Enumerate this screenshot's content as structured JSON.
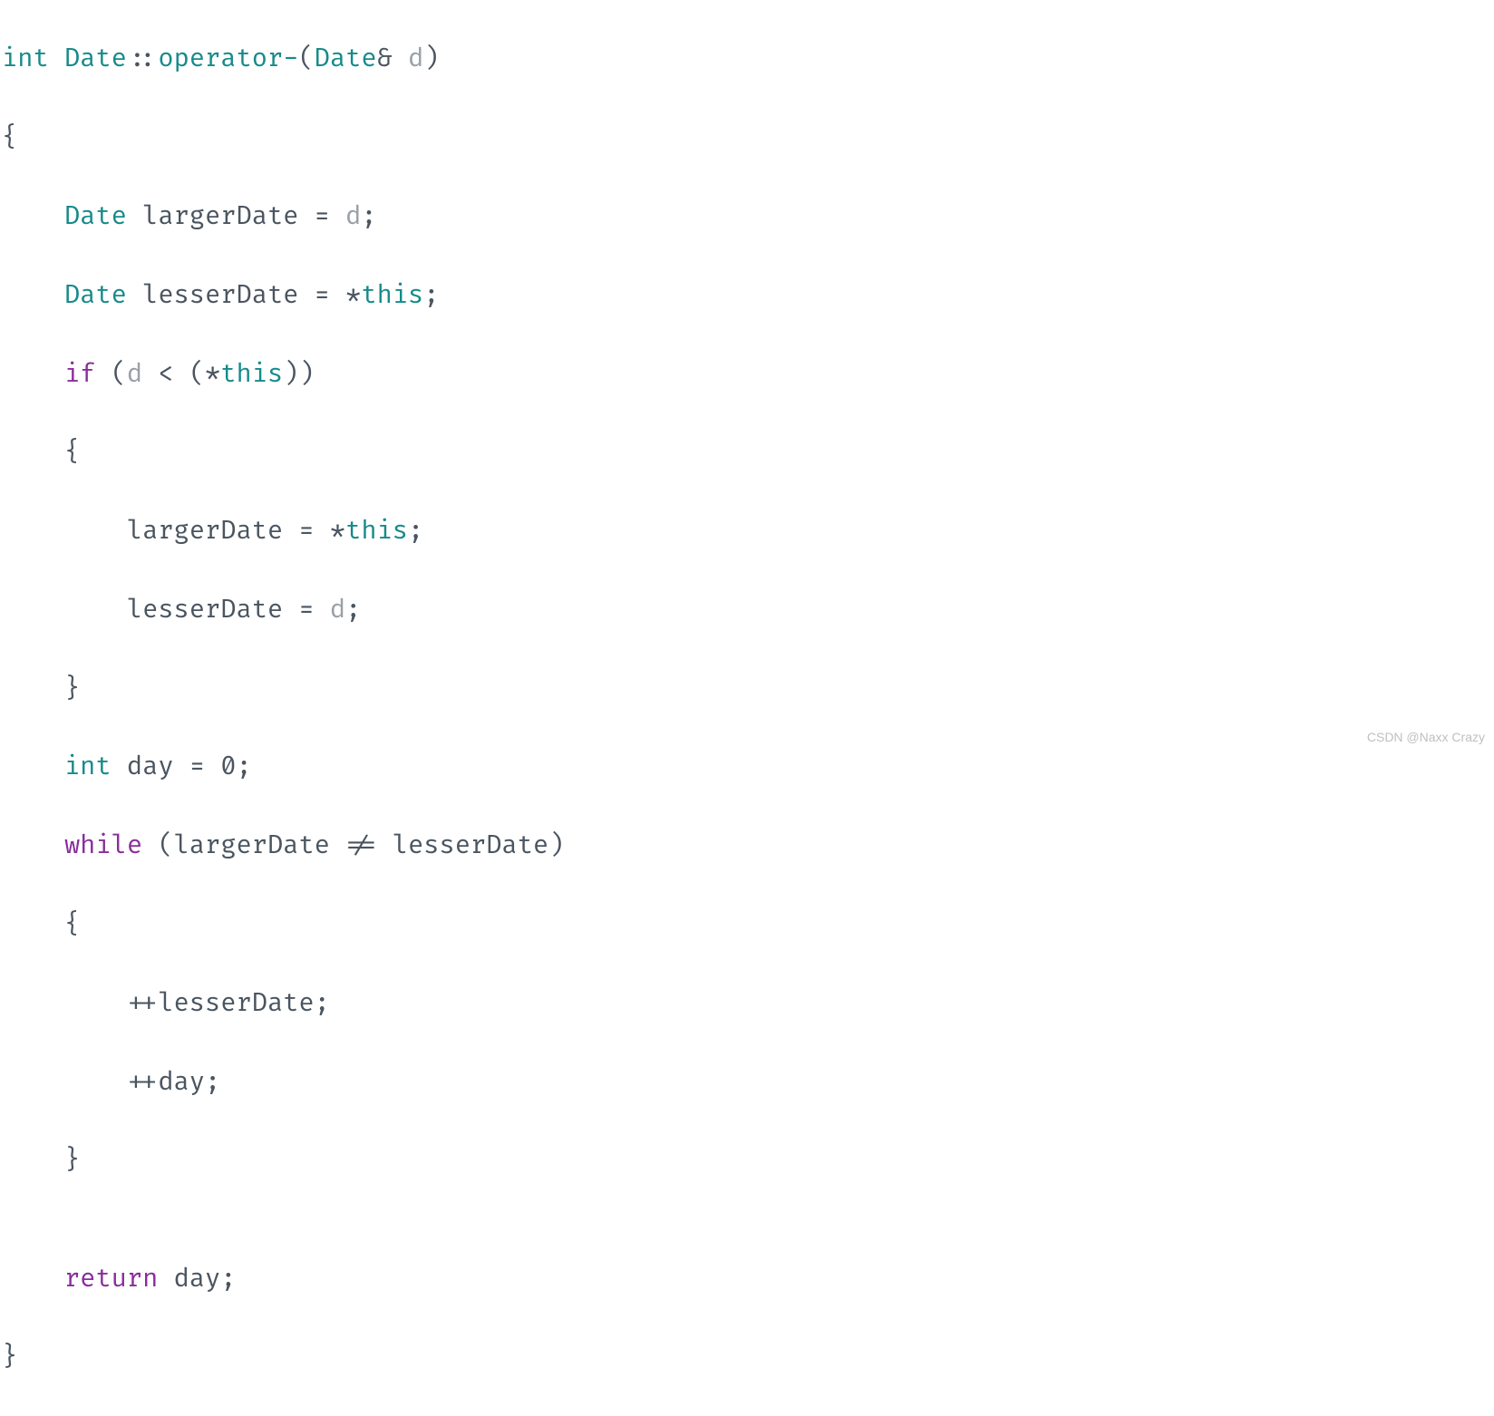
{
  "code": {
    "l1": {
      "t1": "int",
      "sp1": " ",
      "t2": "Date",
      "t3": "::",
      "t4": "operator-",
      "t5": "(",
      "t6": "Date",
      "t7": "&",
      "sp2": " ",
      "t8": "d",
      "t9": ")"
    },
    "l2": {
      "t1": "{"
    },
    "l3": {
      "indent": "    ",
      "t1": "Date",
      "sp1": " ",
      "t2": "largerDate",
      "sp2": " ",
      "t3": "=",
      "sp3": " ",
      "t4": "d",
      "t5": ";"
    },
    "l4": {
      "indent": "    ",
      "t1": "Date",
      "sp1": " ",
      "t2": "lesserDate",
      "sp2": " ",
      "t3": "=",
      "sp3": " ",
      "t4": "*",
      "t5": "this",
      "t6": ";"
    },
    "l5": {
      "indent": "    ",
      "t1": "if",
      "sp1": " ",
      "t2": "(",
      "t3": "d",
      "sp2": " ",
      "t4": "<",
      "sp3": " ",
      "t5": "(",
      "t6": "*",
      "t7": "this",
      "t8": ")",
      "t9": ")"
    },
    "l6": {
      "indent": "    ",
      "t1": "{"
    },
    "l7": {
      "indent": "        ",
      "t1": "largerDate",
      "sp1": " ",
      "t2": "=",
      "sp2": " ",
      "t3": "*",
      "t4": "this",
      "t5": ";"
    },
    "l8": {
      "indent": "        ",
      "t1": "lesserDate",
      "sp1": " ",
      "t2": "=",
      "sp2": " ",
      "t3": "d",
      "t4": ";"
    },
    "l9": {
      "indent": "    ",
      "t1": "}"
    },
    "l10": {
      "indent": "    ",
      "t1": "int",
      "sp1": " ",
      "t2": "day",
      "sp2": " ",
      "t3": "=",
      "sp3": " ",
      "t4": "0",
      "t5": ";"
    },
    "l11": {
      "indent": "    ",
      "t1": "while",
      "sp1": " ",
      "t2": "(",
      "t3": "largerDate",
      "sp2": " ",
      "t4": "!=",
      "sp3": " ",
      "t5": "lesserDate",
      "t6": ")"
    },
    "l12": {
      "indent": "    ",
      "t1": "{"
    },
    "l13": {
      "indent": "        ",
      "t1": "++",
      "t2": "lesserDate",
      "t3": ";"
    },
    "l14": {
      "indent": "        ",
      "t1": "++",
      "t2": "day",
      "t3": ";"
    },
    "l15": {
      "indent": "    ",
      "t1": "}"
    },
    "l16": {
      "indent": ""
    },
    "l17": {
      "indent": "    ",
      "t1": "return",
      "sp1": " ",
      "t2": "day",
      "t3": ";"
    },
    "l18": {
      "t1": "}"
    }
  },
  "watermark": "CSDN @Naxx Crazy"
}
